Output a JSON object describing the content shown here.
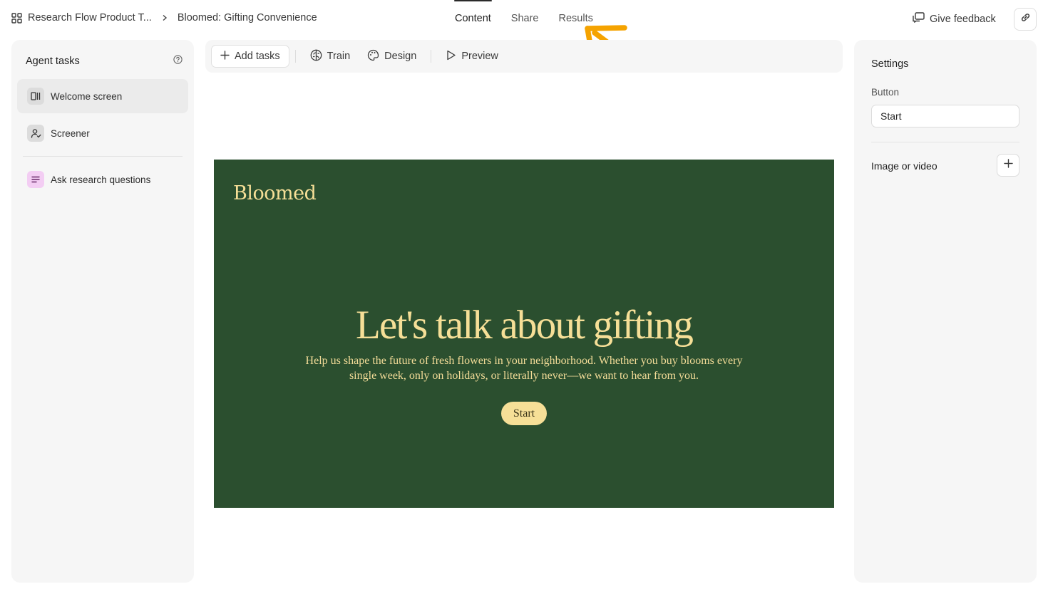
{
  "header": {
    "project": "Research Flow Product T...",
    "study": "Bloomed: Gifting Convenience",
    "tabs": [
      {
        "label": "Content",
        "active": true
      },
      {
        "label": "Share",
        "active": false
      },
      {
        "label": "Results",
        "active": false
      }
    ],
    "feedback_label": "Give feedback",
    "icons": {
      "apps": "grid-icon",
      "separator": "chevron-right-icon",
      "feedback": "message-icon",
      "copy_link": "link-icon"
    }
  },
  "sidebar": {
    "title": "Agent tasks",
    "help_icon": "help-circle-icon",
    "items": [
      {
        "label": "Welcome screen",
        "icon": "layout-icon",
        "selected": true
      },
      {
        "label": "Screener",
        "icon": "user-check-icon",
        "selected": false
      },
      {
        "label": "Ask research questions",
        "icon": "lines-icon",
        "selected": false
      }
    ]
  },
  "toolbar": {
    "add_tasks": "Add tasks",
    "train": "Train",
    "design": "Design",
    "preview": "Preview"
  },
  "preview": {
    "brand": "Bloomed",
    "title": "Let's talk about gifting",
    "subtitle_line1": "Help us shape the future of fresh flowers in your neighborhood. Whether you buy blooms every",
    "subtitle_line2": "single week, only on holidays, or literally never—we want to hear from you.",
    "button": "Start",
    "colors": {
      "background": "#2b4f2f",
      "accent": "#f6df97"
    }
  },
  "settings": {
    "title": "Settings",
    "button_label": "Button",
    "button_value": "Start",
    "media_label": "Image or video"
  },
  "annotation": {
    "color": "#f5a300",
    "icon": "arrow-up-left-icon"
  }
}
